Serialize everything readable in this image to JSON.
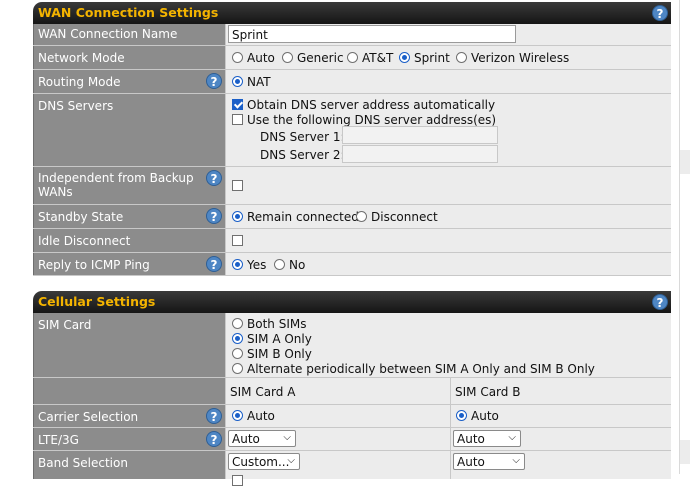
{
  "wan": {
    "header": "WAN Connection Settings",
    "help": "?",
    "rows": {
      "name": {
        "label": "WAN Connection Name",
        "value": "Sprint"
      },
      "network_mode": {
        "label": "Network Mode",
        "options": [
          "Auto",
          "Generic",
          "AT&T",
          "Sprint",
          "Verizon Wireless"
        ],
        "selected": "Sprint"
      },
      "routing_mode": {
        "label": "Routing Mode",
        "option": "NAT"
      },
      "dns": {
        "label": "DNS Servers",
        "auto_label": "Obtain DNS server address automatically",
        "manual_label": "Use the following DNS server address(es)",
        "server1_label": "DNS Server 1:",
        "server2_label": "DNS Server 2:",
        "server1_value": "",
        "server2_value": ""
      },
      "independent": {
        "label": "Independent from Backup WANs"
      },
      "standby": {
        "label": "Standby State",
        "opt1": "Remain connected",
        "opt2": "Disconnect"
      },
      "idle": {
        "label": "Idle Disconnect"
      },
      "icmp": {
        "label": "Reply to ICMP Ping",
        "opt1": "Yes",
        "opt2": "No"
      }
    }
  },
  "cellular": {
    "header": "Cellular Settings",
    "help": "?",
    "sim": {
      "label": "SIM Card",
      "options": [
        "Both SIMs",
        "SIM A Only",
        "SIM B Only",
        "Alternate periodically between SIM A Only and SIM B Only"
      ],
      "selected": "SIM A Only"
    },
    "col_a": "SIM Card A",
    "col_b": "SIM Card B",
    "carrier": {
      "label": "Carrier Selection",
      "a": "Auto",
      "b": "Auto"
    },
    "lte": {
      "label": "LTE/3G",
      "a": "Auto",
      "b": "Auto"
    },
    "band": {
      "label": "Band Selection",
      "a": "Custom...",
      "b": "Auto"
    }
  }
}
